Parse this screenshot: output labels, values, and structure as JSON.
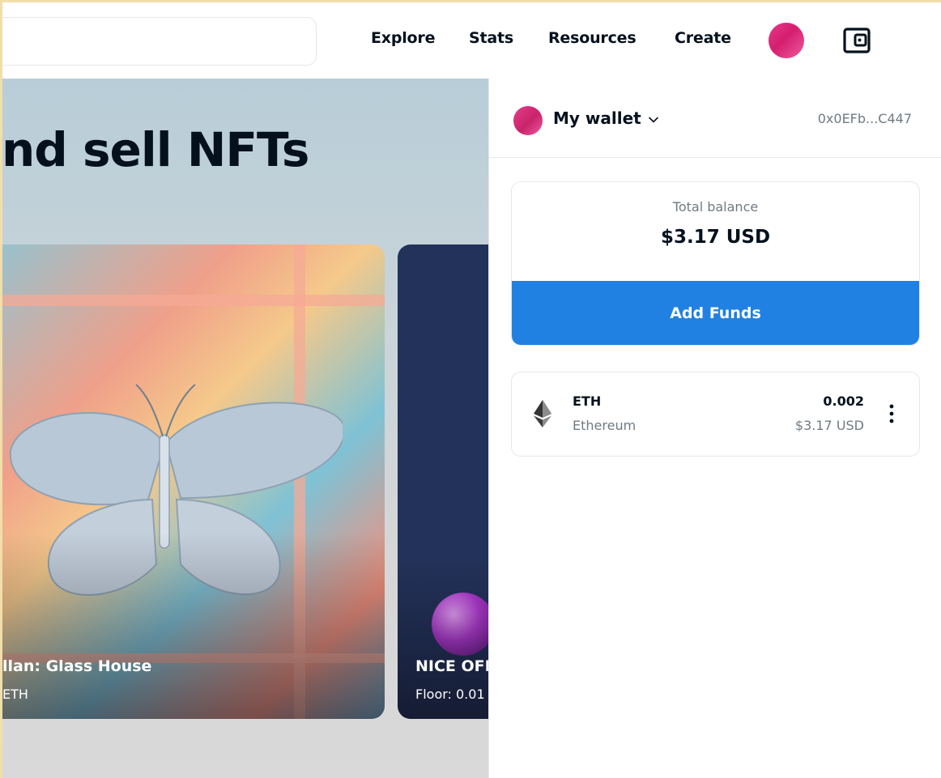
{
  "nav": {
    "explore": "Explore",
    "stats": "Stats",
    "resources": "Resources",
    "create": "Create"
  },
  "hero": {
    "title": "nd sell NFTs",
    "cards": [
      {
        "name": "llan: Glass House",
        "floor": "ETH"
      },
      {
        "name": "NICE OFF",
        "floor": "Floor: 0.01"
      }
    ]
  },
  "wallet": {
    "title": "My wallet",
    "address": "0x0EFb...C447",
    "balance_label": "Total balance",
    "balance_value": "$3.17 USD",
    "add_funds_label": "Add Funds",
    "tokens": [
      {
        "symbol": "ETH",
        "name": "Ethereum",
        "amount": "0.002",
        "usd": "$3.17 USD"
      }
    ]
  },
  "colors": {
    "accent": "#2081e2",
    "avatar": "#d41e6e",
    "outer_border": "#f2deaa"
  },
  "icons": [
    "wallet-icon",
    "chevron-down-icon",
    "ethereum-icon",
    "more-vertical-icon"
  ]
}
